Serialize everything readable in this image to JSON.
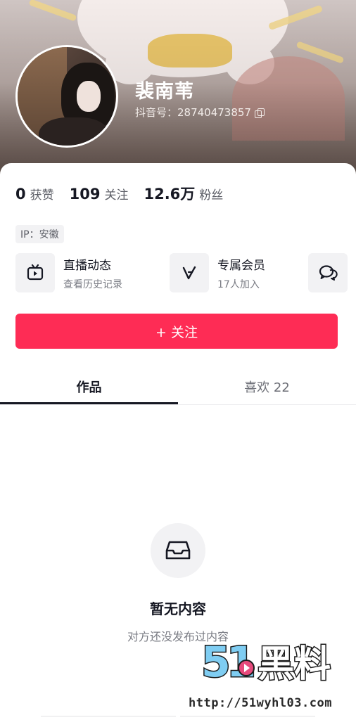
{
  "profile": {
    "name": "裴南苇",
    "douyin_id": "抖音号：28740473857"
  },
  "stats": [
    {
      "value": "0",
      "label": "获赞"
    },
    {
      "value": "109",
      "label": "关注"
    },
    {
      "value": "12.6万",
      "label": "粉丝"
    }
  ],
  "ip_tag": "IP：安徽",
  "features": {
    "live": {
      "title": "直播动态",
      "subtitle": "查看历史记录",
      "icon": "tv-icon"
    },
    "member": {
      "title": "专属会员",
      "subtitle": "17人加入",
      "icon": "v-badge-icon"
    },
    "message": {
      "icon": "chat-bubbles-icon"
    }
  },
  "follow_button": "+ 关注",
  "tabs": [
    {
      "label": "作品",
      "active": true
    },
    {
      "label": "喜欢 22",
      "active": false
    }
  ],
  "empty_state": {
    "icon": "inbox-tray-icon",
    "title": "暂无内容",
    "subtitle": "对方还没发布过内容"
  },
  "watermark": {
    "logo_text": "51黑料",
    "url": "http://51wyhl03.com"
  },
  "colors": {
    "accent": "#fe2c55",
    "text_primary": "#161823",
    "text_secondary": "#5c5e66",
    "chip_bg": "#f2f2f4"
  }
}
